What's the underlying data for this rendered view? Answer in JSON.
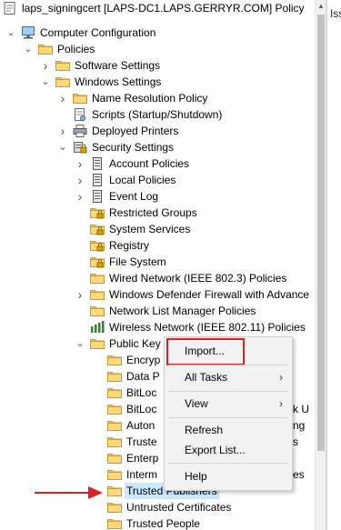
{
  "window": {
    "title": "laps_signingcert [LAPS-DC1.LAPS.GERRYR.COM] Policy"
  },
  "right_pane": {
    "text": "Iss"
  },
  "tree": [
    {
      "label": "Computer Configuration",
      "icon": "computer-icon",
      "chevron": "down"
    },
    {
      "label": "Policies",
      "icon": "folder-icon",
      "chevron": "down"
    },
    {
      "label": "Software Settings",
      "icon": "folder-icon",
      "chevron": "right"
    },
    {
      "label": "Windows Settings",
      "icon": "folder-icon",
      "chevron": "down"
    },
    {
      "label": "Name Resolution Policy",
      "icon": "folder-icon",
      "chevron": "right"
    },
    {
      "label": "Scripts (Startup/Shutdown)",
      "icon": "script-icon",
      "chevron": ""
    },
    {
      "label": "Deployed Printers",
      "icon": "printer-icon",
      "chevron": "right"
    },
    {
      "label": "Security Settings",
      "icon": "security-icon",
      "chevron": "down"
    },
    {
      "label": "Account Policies",
      "icon": "policy-icon",
      "chevron": "right"
    },
    {
      "label": "Local Policies",
      "icon": "policy-icon",
      "chevron": "right"
    },
    {
      "label": "Event Log",
      "icon": "policy-icon",
      "chevron": "right"
    },
    {
      "label": "Restricted Groups",
      "icon": "locked-folder-icon",
      "chevron": ""
    },
    {
      "label": "System Services",
      "icon": "locked-folder-icon",
      "chevron": ""
    },
    {
      "label": "Registry",
      "icon": "locked-folder-icon",
      "chevron": ""
    },
    {
      "label": "File System",
      "icon": "locked-folder-icon",
      "chevron": ""
    },
    {
      "label": "Wired Network (IEEE 802.3) Policies",
      "icon": "folder-icon",
      "chevron": ""
    },
    {
      "label": "Windows Defender Firewall with Advance",
      "icon": "folder-icon",
      "chevron": "right"
    },
    {
      "label": "Network List Manager Policies",
      "icon": "folder-icon",
      "chevron": ""
    },
    {
      "label": "Wireless Network (IEEE 802.11) Policies",
      "icon": "wireless-icon",
      "chevron": ""
    },
    {
      "label": "Public Key",
      "icon": "folder-icon",
      "chevron": "down"
    },
    {
      "label": "Encryp",
      "icon": "folder-icon",
      "chevron": ""
    },
    {
      "label": "Data P",
      "icon": "folder-icon",
      "chevron": ""
    },
    {
      "label": "BitLoc",
      "icon": "folder-icon",
      "chevron": ""
    },
    {
      "label": "BitLoc",
      "icon": "folder-icon",
      "chevron": ""
    },
    {
      "label": "Auton",
      "icon": "folder-icon",
      "chevron": ""
    },
    {
      "label": "Truste",
      "icon": "folder-icon",
      "chevron": ""
    },
    {
      "label": "Enterp",
      "icon": "folder-icon",
      "chevron": ""
    },
    {
      "label": "Interm",
      "icon": "folder-icon",
      "chevron": ""
    },
    {
      "label": "Trusted Publishers",
      "icon": "folder-icon",
      "chevron": "",
      "selected": true
    },
    {
      "label": "Untrusted Certificates",
      "icon": "folder-icon",
      "chevron": ""
    },
    {
      "label": "Trusted People",
      "icon": "folder-icon",
      "chevron": ""
    }
  ],
  "peek_text": {
    "row_23": "k U",
    "row_24": "ng",
    "row_26": "s",
    "row_27": "es"
  },
  "context_menu": {
    "items": [
      {
        "label": "Import...",
        "submenu": false,
        "highlighted": true
      },
      {
        "label": "All Tasks",
        "submenu": true
      },
      {
        "label": "View",
        "submenu": true
      },
      {
        "label": "Refresh",
        "submenu": false
      },
      {
        "label": "Export List...",
        "submenu": false
      },
      {
        "label": "Help",
        "submenu": false
      }
    ]
  },
  "colors": {
    "annotation": "#e02020",
    "folder": "#f3c95a",
    "selection": "#cce8ff"
  }
}
